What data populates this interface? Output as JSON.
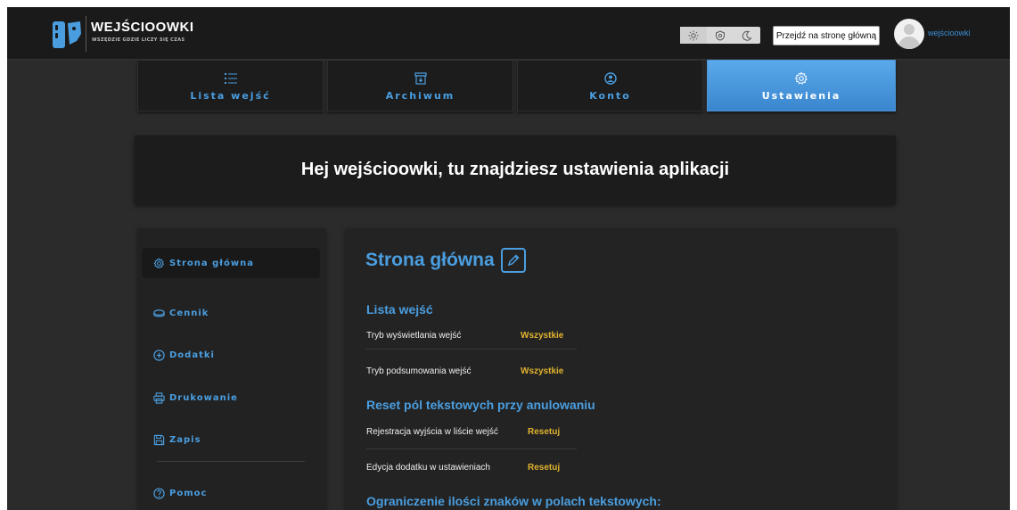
{
  "header": {
    "brand": "WEJŚCIOOWKI",
    "tagline": "WSZĘDZIE GDZIE LICZY SIĘ CZAS",
    "theme_icons": [
      "sun-icon",
      "shield-icon",
      "moon-icon"
    ],
    "home_button": "Przejdź na stronę główną",
    "username": "wejścioowki"
  },
  "tabs": [
    {
      "label": "Lista wejść",
      "icon": "list-icon",
      "active": false
    },
    {
      "label": "Archiwum",
      "icon": "archive-icon",
      "active": false
    },
    {
      "label": "Konto",
      "icon": "user-circle-icon",
      "active": false
    },
    {
      "label": "Ustawienia",
      "icon": "gear-icon",
      "active": true
    }
  ],
  "banner": {
    "text": "Hej wejścioowki, tu znajdziesz ustawienia aplikacji"
  },
  "sidebar": {
    "items": [
      {
        "label": "Strona główna",
        "icon": "gear-icon",
        "active": true
      },
      {
        "label": "Cennik",
        "icon": "wallet-icon",
        "active": false
      },
      {
        "label": "Dodatki",
        "icon": "plus-circle-icon",
        "active": false
      },
      {
        "label": "Drukowanie",
        "icon": "printer-icon",
        "active": false
      },
      {
        "label": "Zapis",
        "icon": "save-icon",
        "active": false
      },
      {
        "label": "Pomoc",
        "icon": "help-circle-icon",
        "active": false
      }
    ]
  },
  "main": {
    "title": "Strona główna",
    "sections": [
      {
        "heading": "Lista wejść",
        "rows": [
          {
            "label": "Tryb wyświetlania wejść",
            "value": "Wszystkie"
          },
          {
            "label": "Tryb podsumowania wejść",
            "value": "Wszystkie"
          }
        ]
      },
      {
        "heading": "Reset pól tekstowych przy anulowaniu",
        "rows": [
          {
            "label": "Rejestracja wyjścia w liście wejść",
            "value": "Resetuj"
          },
          {
            "label": "Edycja dodatku w ustawieniach",
            "value": "Resetuj"
          }
        ]
      },
      {
        "heading": "Ograniczenie ilości znaków w polach tekstowych:",
        "rows": []
      }
    ]
  },
  "colors": {
    "accent": "#4a9ee0",
    "value": "#e0b32f",
    "background": "#2b2b2b",
    "card": "#1c1c1c"
  }
}
